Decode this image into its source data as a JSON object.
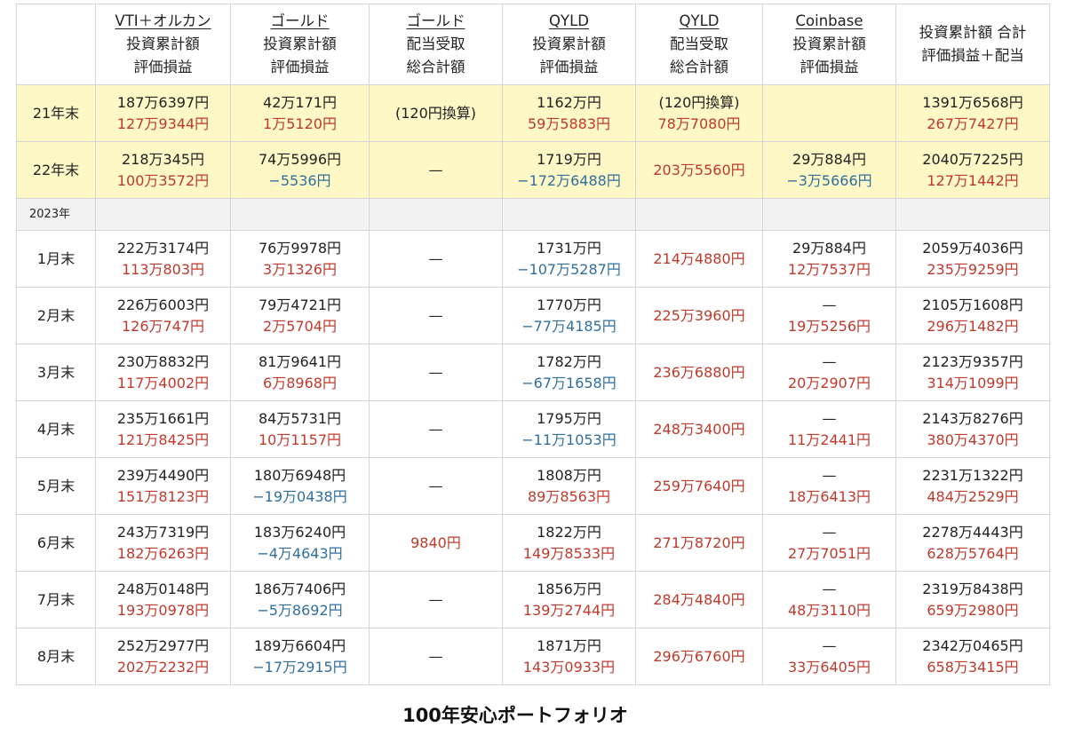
{
  "headers": [
    {
      "line1": "",
      "line2": "",
      "line3": ""
    },
    {
      "line1": "VTI＋オルカン",
      "line2": "投資累計額",
      "line3": "評価損益"
    },
    {
      "line1": "ゴールド",
      "line2": "投資累計額",
      "line3": "評価損益"
    },
    {
      "line1": "ゴールド",
      "line2": "配当受取",
      "line3": "総合計額"
    },
    {
      "line1": "QYLD",
      "line2": "投資累計額",
      "line3": "評価損益"
    },
    {
      "line1": "QYLD",
      "line2": "配当受取",
      "line3": "総合計額"
    },
    {
      "line1": "Coinbase",
      "line2": "投資累計額",
      "line3": "評価損益"
    },
    {
      "line1": "投資累計額 合計",
      "line2": "評価損益＋配当",
      "line3": ""
    }
  ],
  "year_label": "2023年",
  "caption": "100年安心ポートフォリオ",
  "rows": [
    {
      "label": "21年末",
      "vti": {
        "a": "187万6397円",
        "b": "127万9344円"
      },
      "gold": {
        "a": "42万171円",
        "b": "1万5120円"
      },
      "gold_div": "(120円換算)",
      "qyld": {
        "a": "1162万円",
        "b": "59万5883円"
      },
      "qyld_div": {
        "a": "(120円換算)",
        "b": "78万7080円"
      },
      "coin": {
        "a": "",
        "b": ""
      },
      "total": {
        "a": "1391万6568円",
        "b": "267万7427円"
      }
    },
    {
      "label": "22年末",
      "vti": {
        "a": "218万345円",
        "b": "100万3572円"
      },
      "gold": {
        "a": "74万5996円",
        "b": "−5536円"
      },
      "gold_div": "—",
      "qyld": {
        "a": "1719万円",
        "b": "−172万6488円"
      },
      "qyld_div": {
        "a": "",
        "b": "203万5560円"
      },
      "coin": {
        "a": "29万884円",
        "b": "−3万5666円"
      },
      "total": {
        "a": "2040万7225円",
        "b": "127万1442円"
      }
    },
    {
      "label": "1月末",
      "vti": {
        "a": "222万3174円",
        "b": "113万803円"
      },
      "gold": {
        "a": "76万9978円",
        "b": "3万1326円"
      },
      "gold_div": "—",
      "qyld": {
        "a": "1731万円",
        "b": "−107万5287円"
      },
      "qyld_div": {
        "a": "",
        "b": "214万4880円"
      },
      "coin": {
        "a": "29万884円",
        "b": "12万7537円"
      },
      "total": {
        "a": "2059万4036円",
        "b": "235万9259円"
      }
    },
    {
      "label": "2月末",
      "vti": {
        "a": "226万6003円",
        "b": "126万747円"
      },
      "gold": {
        "a": "79万4721円",
        "b": "2万5704円"
      },
      "gold_div": "—",
      "qyld": {
        "a": "1770万円",
        "b": "−77万4185円"
      },
      "qyld_div": {
        "a": "",
        "b": "225万3960円"
      },
      "coin": {
        "a": "—",
        "b": "19万5256円"
      },
      "total": {
        "a": "2105万1608円",
        "b": "296万1482円"
      }
    },
    {
      "label": "3月末",
      "vti": {
        "a": "230万8832円",
        "b": "117万4002円"
      },
      "gold": {
        "a": "81万9641円",
        "b": "6万8968円"
      },
      "gold_div": "—",
      "qyld": {
        "a": "1782万円",
        "b": "−67万1658円"
      },
      "qyld_div": {
        "a": "",
        "b": "236万6880円"
      },
      "coin": {
        "a": "—",
        "b": "20万2907円"
      },
      "total": {
        "a": "2123万9357円",
        "b": "314万1099円"
      }
    },
    {
      "label": "4月末",
      "vti": {
        "a": "235万1661円",
        "b": "121万8425円"
      },
      "gold": {
        "a": "84万5731円",
        "b": "10万1157円"
      },
      "gold_div": "—",
      "qyld": {
        "a": "1795万円",
        "b": "−11万1053円"
      },
      "qyld_div": {
        "a": "",
        "b": "248万3400円"
      },
      "coin": {
        "a": "—",
        "b": "11万2441円"
      },
      "total": {
        "a": "2143万8276円",
        "b": "380万4370円"
      }
    },
    {
      "label": "5月末",
      "vti": {
        "a": "239万4490円",
        "b": "151万8123円"
      },
      "gold": {
        "a": "180万6948円",
        "b": "−19万0438円"
      },
      "gold_div": "—",
      "qyld": {
        "a": "1808万円",
        "b": "89万8563円"
      },
      "qyld_div": {
        "a": "",
        "b": "259万7640円"
      },
      "coin": {
        "a": "—",
        "b": "18万6413円"
      },
      "total": {
        "a": "2231万1322円",
        "b": "484万2529円"
      }
    },
    {
      "label": "6月末",
      "vti": {
        "a": "243万7319円",
        "b": "182万6263円"
      },
      "gold": {
        "a": "183万6240円",
        "b": "−4万4643円"
      },
      "gold_div": "9840円",
      "qyld": {
        "a": "1822万円",
        "b": "149万8533円"
      },
      "qyld_div": {
        "a": "",
        "b": "271万8720円"
      },
      "coin": {
        "a": "—",
        "b": "27万7051円"
      },
      "total": {
        "a": "2278万4443円",
        "b": "628万5764円"
      }
    },
    {
      "label": "7月末",
      "vti": {
        "a": "248万0148円",
        "b": "193万0978円"
      },
      "gold": {
        "a": "186万7406円",
        "b": "−5万8692円"
      },
      "gold_div": "—",
      "qyld": {
        "a": "1856万円",
        "b": "139万2744円"
      },
      "qyld_div": {
        "a": "",
        "b": "284万4840円"
      },
      "coin": {
        "a": "—",
        "b": "48万3110円"
      },
      "total": {
        "a": "2319万8438円",
        "b": "659万2980円"
      }
    },
    {
      "label": "8月末",
      "vti": {
        "a": "252万2977円",
        "b": "202万2232円"
      },
      "gold": {
        "a": "189万6604円",
        "b": "−17万2915円"
      },
      "gold_div": "—",
      "qyld": {
        "a": "1871万円",
        "b": "143万0933円"
      },
      "qyld_div": {
        "a": "",
        "b": "296万6760円"
      },
      "coin": {
        "a": "—",
        "b": "33万6405円"
      },
      "total": {
        "a": "2342万0465円",
        "b": "658万3415円"
      }
    }
  ],
  "colors": {
    "highlight_row": "#fdf8c6",
    "year_row": "#f2f2f2",
    "gain": "#c0392b",
    "loss": "#2f6f9f",
    "grid_line": "#d6d6d6"
  }
}
